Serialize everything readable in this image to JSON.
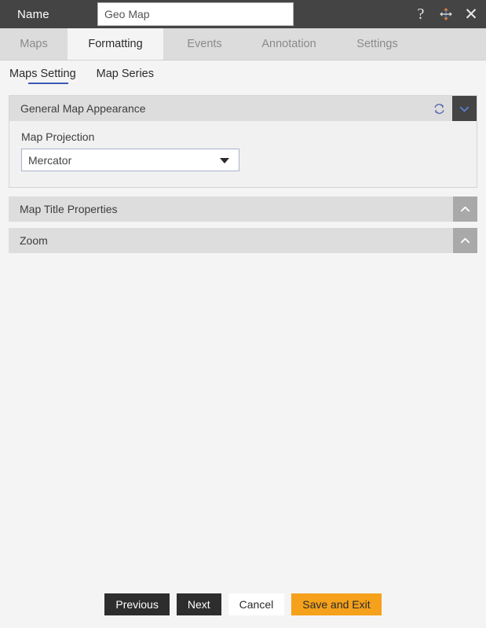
{
  "titlebar": {
    "name_label": "Name",
    "name_value": "Geo Map",
    "name_placeholder": "Name",
    "help_icon": "question-mark-icon",
    "move_icon": "move-arrows-icon",
    "close_icon": "close-x-icon",
    "close_glyph": "✕",
    "help_glyph": "?"
  },
  "tabs": [
    {
      "label": "Maps",
      "active": false
    },
    {
      "label": "Formatting",
      "active": true
    },
    {
      "label": "Events",
      "active": false
    },
    {
      "label": "Annotation",
      "active": false
    },
    {
      "label": "Settings",
      "active": false
    }
  ],
  "subtabs": [
    {
      "label": "Maps Setting",
      "active": true
    },
    {
      "label": "Map Series",
      "active": false
    }
  ],
  "sections": {
    "general_map_appearance": {
      "title": "General Map Appearance",
      "expanded": true,
      "refresh_icon": "refresh-icon",
      "collapse_icon": "chevron-down-icon",
      "field": {
        "label": "Map Projection",
        "value": "Mercator",
        "options": [
          "Mercator"
        ]
      }
    },
    "collapsed": [
      {
        "title": "Map Title Properties",
        "expand_icon": "chevron-up-icon"
      },
      {
        "title": "Zoom",
        "expand_icon": "chevron-up-icon"
      }
    ]
  },
  "footer": {
    "previous_label": "Previous",
    "next_label": "Next",
    "cancel_label": "Cancel",
    "save_label": "Save and Exit"
  },
  "colors": {
    "titlebar_bg": "#444444",
    "tabbar_bg": "#dcdcdc",
    "page_bg": "#f4f4f4",
    "panel_header_bg": "#dddddd",
    "accent_blue": "#3b5bb5",
    "accent_orange": "#f5a11b",
    "collapsed_btn_bg": "#a9a9a9",
    "dark_btn_bg": "#2d2d2d"
  }
}
